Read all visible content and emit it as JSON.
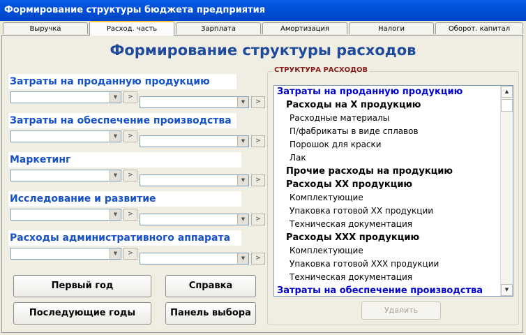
{
  "window": {
    "title": "Формирование структуры бюджета предприятия"
  },
  "tabs": [
    {
      "label": "Выручка"
    },
    {
      "label": "Расход. часть",
      "active": true
    },
    {
      "label": "Зарплата"
    },
    {
      "label": "Амортизация"
    },
    {
      "label": "Налоги"
    },
    {
      "label": "Оборот. капитал"
    }
  ],
  "page": {
    "heading": "Формирование структуры расходов"
  },
  "categories": [
    {
      "label": "Затраты на проданную продукцию",
      "arrow": ">"
    },
    {
      "label": "Затраты на обеспечение производства",
      "arrow": ">"
    },
    {
      "label": "Маркетинг",
      "arrow": ">"
    },
    {
      "label": "Исследование и развитие",
      "arrow": ">"
    },
    {
      "label": "Расходы административного аппарата",
      "arrow": ">"
    }
  ],
  "buttons": {
    "first_year": "Первый год",
    "help": "Справка",
    "next_years": "Последующие годы",
    "select_panel": "Панель выбора",
    "delete": "Удалить"
  },
  "structure": {
    "title": "СТРУКТУРА РАСХОДОВ",
    "items": [
      {
        "text": "Затраты на проданную продукцию",
        "level": 1
      },
      {
        "text": "Расходы на X продукцию",
        "level": 2
      },
      {
        "text": "Расходные материалы",
        "level": 3
      },
      {
        "text": "П/фабрикаты в виде сплавов",
        "level": 3
      },
      {
        "text": "Порошок для краски",
        "level": 3
      },
      {
        "text": "Лак",
        "level": 3
      },
      {
        "text": "Прочие расходы на продукцию",
        "level": 2
      },
      {
        "text": "Расходы XX продукцию",
        "level": 2
      },
      {
        "text": "Комплектующие",
        "level": 3
      },
      {
        "text": "Упаковка готовой XX продукции",
        "level": 3
      },
      {
        "text": "Техническая документация",
        "level": 3
      },
      {
        "text": "Расходы XXX продукцию",
        "level": 2
      },
      {
        "text": "Комплектующие",
        "level": 3
      },
      {
        "text": "Упаковка готовой XXX продукции",
        "level": 3
      },
      {
        "text": "Техническая документация",
        "level": 3
      },
      {
        "text": "Затраты на обеспечение производства",
        "level": 1
      }
    ]
  },
  "icons": {
    "dropdown": "chevron-down-icon",
    "scroll_up": "arrow-up-icon",
    "scroll_down": "arrow-down-icon"
  }
}
